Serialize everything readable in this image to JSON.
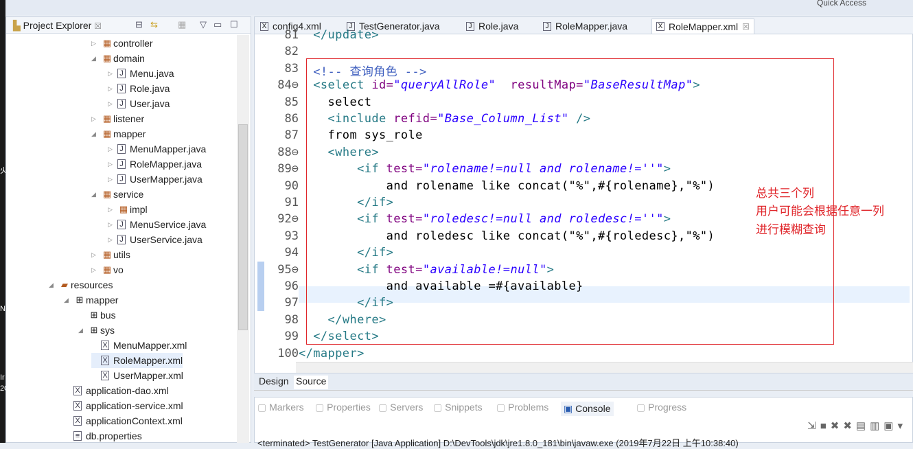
{
  "topbar": {
    "quick_access": "Quick Access"
  },
  "left_strip": [
    "火",
    "N",
    "Ir",
    "20"
  ],
  "explorer": {
    "title": "Project Explorer",
    "close_glyph": "☒",
    "items": [
      {
        "label": "controller",
        "type": "package",
        "arrow": "▷",
        "level": 4
      },
      {
        "label": "domain",
        "type": "package",
        "arrow": "◢",
        "level": 4
      },
      {
        "label": "Menu.java",
        "type": "java",
        "arrow": "▷",
        "level": 5
      },
      {
        "label": "Role.java",
        "type": "java",
        "arrow": "▷",
        "level": 5
      },
      {
        "label": "User.java",
        "type": "java",
        "arrow": "▷",
        "level": 5
      },
      {
        "label": "listener",
        "type": "package",
        "arrow": "▷",
        "level": 4
      },
      {
        "label": "mapper",
        "type": "package",
        "arrow": "◢",
        "level": 4
      },
      {
        "label": "MenuMapper.java",
        "type": "interface",
        "arrow": "▷",
        "level": 5
      },
      {
        "label": "RoleMapper.java",
        "type": "interface",
        "arrow": "▷",
        "level": 5
      },
      {
        "label": "UserMapper.java",
        "type": "interface",
        "arrow": "▷",
        "level": 5
      },
      {
        "label": "service",
        "type": "package",
        "arrow": "◢",
        "level": 4
      },
      {
        "label": "impl",
        "type": "package",
        "arrow": "▷",
        "level": 5
      },
      {
        "label": "MenuService.java",
        "type": "interface",
        "arrow": "▷",
        "level": 5
      },
      {
        "label": "UserService.java",
        "type": "interface",
        "arrow": "▷",
        "level": 5
      },
      {
        "label": "utils",
        "type": "package",
        "arrow": "▷",
        "level": 4
      },
      {
        "label": "vo",
        "type": "package",
        "arrow": "▷",
        "level": 4
      },
      {
        "label": "resources",
        "type": "source-folder",
        "arrow": "◢",
        "level": 1
      },
      {
        "label": "mapper",
        "type": "folder",
        "arrow": "◢",
        "level": 2
      },
      {
        "label": "bus",
        "type": "folder",
        "arrow": "",
        "level": 3
      },
      {
        "label": "sys",
        "type": "folder",
        "arrow": "◢",
        "level": 3
      },
      {
        "label": "MenuMapper.xml",
        "type": "xml",
        "arrow": "",
        "level": 4
      },
      {
        "label": "RoleMapper.xml",
        "type": "xml",
        "arrow": "",
        "level": 4,
        "selected": true
      },
      {
        "label": "UserMapper.xml",
        "type": "xml",
        "arrow": "",
        "level": 4
      },
      {
        "label": "application-dao.xml",
        "type": "xml",
        "arrow": "",
        "level": 2
      },
      {
        "label": "application-service.xml",
        "type": "xml",
        "arrow": "",
        "level": 2
      },
      {
        "label": "applicationContext.xml",
        "type": "xml",
        "arrow": "",
        "level": 2
      },
      {
        "label": "db.properties",
        "type": "file",
        "arrow": "",
        "level": 2
      }
    ]
  },
  "editor": {
    "tabs": [
      {
        "label": "config4.xml",
        "icon": "X"
      },
      {
        "label": "TestGenerator.java",
        "icon": "J"
      },
      {
        "label": "Role.java",
        "icon": "J"
      },
      {
        "label": "RoleMapper.java",
        "icon": "J"
      },
      {
        "label": "RoleMapper.xml",
        "icon": "X",
        "active": true
      }
    ],
    "lines": [
      {
        "n": "81",
        "seg": [
          [
            "t",
            "  "
          ],
          [
            "tag",
            "</update>"
          ]
        ]
      },
      {
        "n": "82",
        "seg": []
      },
      {
        "n": "83",
        "seg": [
          [
            "t",
            "  "
          ],
          [
            "com",
            "<!-- 查询角色 -->"
          ]
        ]
      },
      {
        "n": "84⊖",
        "seg": [
          [
            "t",
            "  "
          ],
          [
            "tag",
            "<select "
          ],
          [
            "attr",
            "id="
          ],
          [
            "val",
            "\"queryAllRole\""
          ],
          [
            "t",
            "  "
          ],
          [
            "attr",
            "resultMap="
          ],
          [
            "val",
            "\"BaseResultMap\""
          ],
          [
            "tag",
            ">"
          ]
        ]
      },
      {
        "n": "85",
        "seg": [
          [
            "t",
            "    select"
          ]
        ]
      },
      {
        "n": "86",
        "seg": [
          [
            "t",
            "    "
          ],
          [
            "tag",
            "<include "
          ],
          [
            "attr",
            "refid="
          ],
          [
            "val",
            "\"Base_Column_List\""
          ],
          [
            "tag",
            " />"
          ]
        ]
      },
      {
        "n": "87",
        "seg": [
          [
            "t",
            "    from sys_role"
          ]
        ]
      },
      {
        "n": "88⊖",
        "seg": [
          [
            "t",
            "    "
          ],
          [
            "tag",
            "<where>"
          ]
        ]
      },
      {
        "n": "89⊖",
        "seg": [
          [
            "t",
            "        "
          ],
          [
            "tag",
            "<if "
          ],
          [
            "attr",
            "test="
          ],
          [
            "val",
            "\"rolename!=null and rolename!=''\""
          ],
          [
            "tag",
            ">"
          ]
        ]
      },
      {
        "n": "90",
        "seg": [
          [
            "t",
            "            and rolename like concat(\"%\",#{rolename},\"%\")"
          ]
        ]
      },
      {
        "n": "91",
        "seg": [
          [
            "t",
            "        "
          ],
          [
            "tag",
            "</if>"
          ]
        ]
      },
      {
        "n": "92⊖",
        "seg": [
          [
            "t",
            "        "
          ],
          [
            "tag",
            "<if "
          ],
          [
            "attr",
            "test="
          ],
          [
            "val",
            "\"roledesc!=null and roledesc!=''\""
          ],
          [
            "tag",
            ">"
          ]
        ]
      },
      {
        "n": "93",
        "seg": [
          [
            "t",
            "            and roledesc like concat(\"%\",#{roledesc},\"%\")"
          ]
        ]
      },
      {
        "n": "94",
        "seg": [
          [
            "t",
            "        "
          ],
          [
            "tag",
            "</if>"
          ]
        ]
      },
      {
        "n": "95⊖",
        "seg": [
          [
            "t",
            "        "
          ],
          [
            "tag",
            "<if "
          ],
          [
            "attr",
            "test="
          ],
          [
            "val",
            "\"available!=null\""
          ],
          [
            "tag",
            ">"
          ]
        ]
      },
      {
        "n": "96",
        "seg": [
          [
            "t",
            "            and available =#{available}"
          ]
        ]
      },
      {
        "n": "97",
        "seg": [
          [
            "t",
            "        "
          ],
          [
            "tag",
            "</if>"
          ]
        ]
      },
      {
        "n": "98",
        "seg": [
          [
            "t",
            "    "
          ],
          [
            "tag",
            "</where>"
          ]
        ]
      },
      {
        "n": "99",
        "seg": [
          [
            "t",
            "  "
          ],
          [
            "tag",
            "</select>"
          ]
        ]
      },
      {
        "n": "100",
        "seg": [
          [
            "tag",
            "</mapper>"
          ]
        ]
      }
    ],
    "annotation": [
      "总共三个列",
      "用户可能会根据任意一列",
      "进行模糊查询"
    ],
    "annotation_color": "#e0262b",
    "design_tab": "Design",
    "source_tab": "Source"
  },
  "bottom": {
    "tabs": [
      "Markers",
      "Properties",
      "Servers",
      "Snippets",
      "Problems",
      "Console",
      "Progress"
    ],
    "active_tab": "Console",
    "console_line": "<terminated> TestGenerator [Java Application] D:\\DevTools\\jdk\\jre1.8.0_181\\bin\\javaw.exe (2019年7月22日 上午10:38:40)"
  }
}
